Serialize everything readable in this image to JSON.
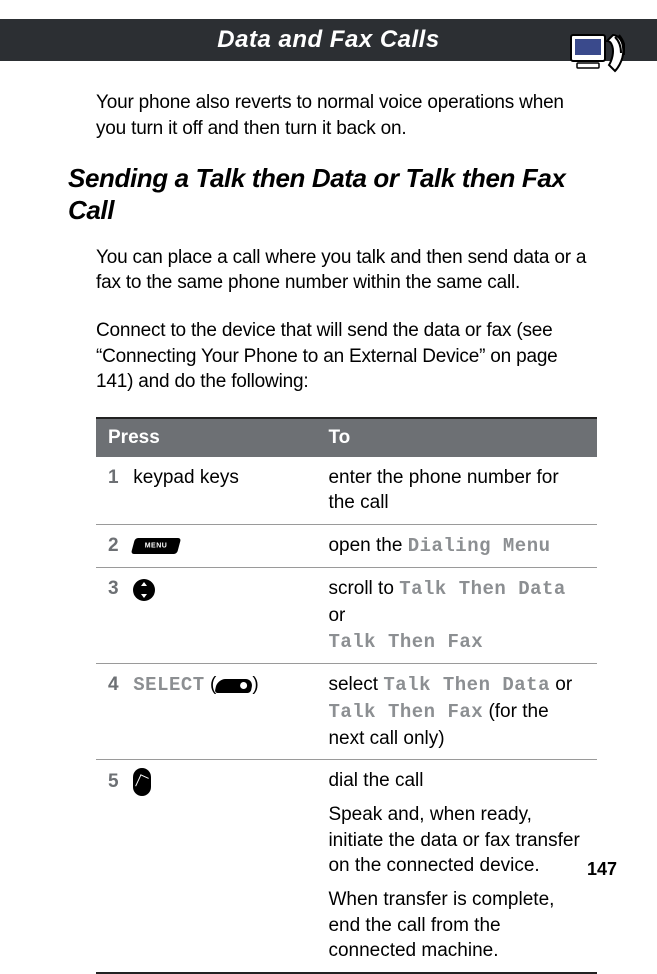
{
  "header": {
    "title": "Data and Fax Calls"
  },
  "intro_para": "Your phone also reverts to normal voice operations when you turn it off and then turn it back on.",
  "section_heading": "Sending a Talk then Data or Talk then Fax Call",
  "section_para1": "You can place a call where you talk and then send data or a fax to the same phone number within the same call.",
  "section_para2": "Connect to the device that will send the data or fax (see “Connecting Your Phone to an External Device” on page 141) and do the following:",
  "table": {
    "head_press": "Press",
    "head_to": "To",
    "rows": [
      {
        "num": "1",
        "press_text": "keypad keys",
        "to_line1": "enter the phone number for the call"
      },
      {
        "num": "2",
        "press_icon": "menu",
        "to_prefix": "open the ",
        "to_mono1": "Dialing Menu"
      },
      {
        "num": "3",
        "press_icon": "scroll",
        "to_prefix": "scroll to ",
        "to_mono1": "Talk Then Data",
        "to_mid": " or ",
        "to_mono2": "Talk Then Fax"
      },
      {
        "num": "4",
        "press_mono": "SELECT",
        "press_paren_open": " (",
        "press_icon": "soft",
        "press_paren_close": ")",
        "to_prefix": "select ",
        "to_mono1": "Talk Then Data",
        "to_mid": " or ",
        "to_mono2": "Talk Then Fax",
        "to_suffix": " (for the next call only)"
      },
      {
        "num": "5",
        "press_icon": "send",
        "to_line1": "dial the call",
        "to_line2": "Speak and, when ready, initiate the data or fax transfer on the connected device.",
        "to_line3": "When transfer is complete, end the call from the connected machine."
      }
    ]
  },
  "page_number": "147"
}
